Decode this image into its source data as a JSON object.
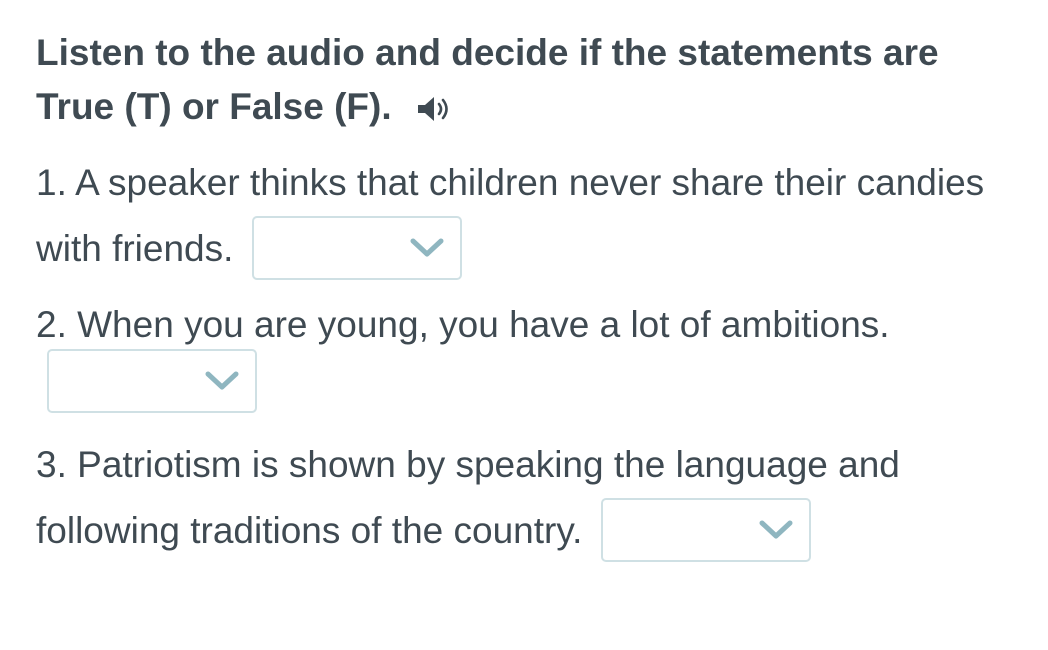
{
  "task": {
    "instructions": "Listen to the audio and decide if the statements are True (T) or False (F).",
    "audio_icon": "speaker-icon"
  },
  "questions": [
    {
      "text": "1. A speaker thinks that children never share their candies with friends.",
      "selected": ""
    },
    {
      "text": "2. When you are young, you have a lot of ambitions.",
      "selected": ""
    },
    {
      "text": "3. Patriotism is shown by speaking the language and following traditions of the country.",
      "selected": ""
    }
  ],
  "colors": {
    "text": "#3f4a52",
    "dropdown_border": "#cfe0e4",
    "chevron": "#8fb6c0"
  }
}
